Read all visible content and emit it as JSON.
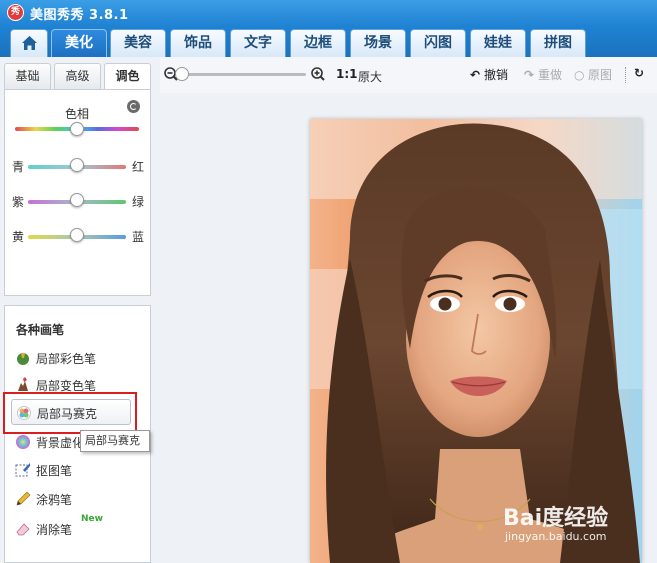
{
  "window": {
    "title": "美图秀秀 3.8.1",
    "logo_text": "秀"
  },
  "tabs": [
    {
      "label": "美化",
      "active": true
    },
    {
      "label": "美容"
    },
    {
      "label": "饰品"
    },
    {
      "label": "文字"
    },
    {
      "label": "边框"
    },
    {
      "label": "场景"
    },
    {
      "label": "闪图"
    },
    {
      "label": "娃娃"
    },
    {
      "label": "拼图"
    }
  ],
  "subtabs": [
    {
      "label": "基础"
    },
    {
      "label": "高级"
    },
    {
      "label": "调色",
      "active": true
    }
  ],
  "color_adjust": {
    "hue": {
      "label": "色相",
      "level": 0.5
    },
    "sliders": [
      {
        "left": "青",
        "right": "红",
        "level": 0.5
      },
      {
        "left": "紫",
        "right": "绿",
        "level": 0.5
      },
      {
        "left": "黄",
        "right": "蓝",
        "level": 0.5
      }
    ]
  },
  "brushes": {
    "title": "各种画笔",
    "items": [
      {
        "label": "局部彩色笔",
        "icon": "color-brush-icon"
      },
      {
        "label": "局部变色笔",
        "icon": "hand-brush-icon"
      },
      {
        "label": "局部马赛克",
        "icon": "mosaic-icon",
        "selected": true
      },
      {
        "label": "背景虚化",
        "icon": "blur-icon"
      },
      {
        "label": "抠图笔",
        "icon": "cutout-pen-icon"
      },
      {
        "label": "涂鸦笔",
        "icon": "pencil-icon"
      },
      {
        "label": "消除笔",
        "icon": "eraser-icon",
        "badge": "New"
      }
    ],
    "tooltip": "局部马赛克"
  },
  "toolbar": {
    "zoom_level": 0.0,
    "one_to_one": "1:1",
    "original_size": "原大",
    "undo": "撤销",
    "redo": "重做",
    "original": "原图"
  },
  "watermark": {
    "brand": "Bai度经验",
    "url": "jingyan.baidu.com"
  },
  "colors": {
    "accent": "#1f82d3",
    "highlight_box": "#d81e1e",
    "new_badge": "#38a832"
  }
}
